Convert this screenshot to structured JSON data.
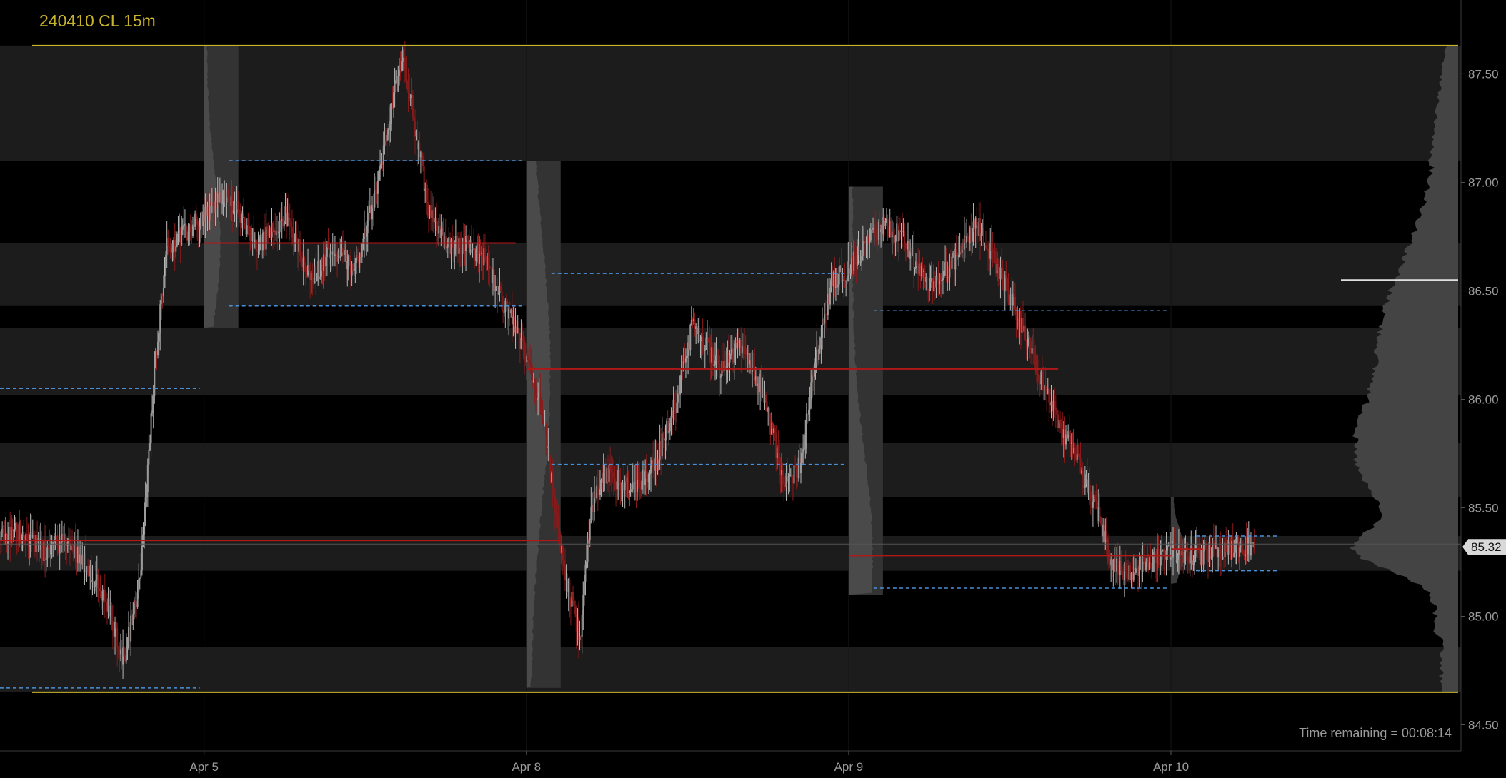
{
  "title": "240410 CL 15m",
  "footer": {
    "label": "Time remaining = ",
    "value": "00:08:14"
  },
  "colors": {
    "background": "#000000",
    "band_light": "#1c1c1c",
    "profile": "#5a5a5a",
    "candle": "#8a1a1a",
    "wick_up": "#b8b8b8",
    "poc": "#b01818",
    "value_area": "#4a90d9",
    "boundary": "#c8b42a",
    "last_price": "#d9d9d9",
    "axis_text": "#9a9a9a"
  },
  "chart_data": {
    "type": "candlestick",
    "instrument": "CL",
    "interval": "15m",
    "xlabel": "",
    "ylabel": "",
    "ylim": [
      84.38,
      87.84
    ],
    "y_ticks": [
      84.5,
      85.0,
      85.5,
      86.0,
      86.5,
      87.0,
      87.5
    ],
    "y_tick_labels": [
      "84.50",
      "85.00",
      "85.50",
      "86.00",
      "86.50",
      "87.00",
      "87.50"
    ],
    "x_ticks": [
      {
        "label": "Apr 5",
        "x": 3
      },
      {
        "label": "Apr 8",
        "x": 6
      },
      {
        "label": "Apr 9",
        "x": 9
      },
      {
        "label": "Apr 10",
        "x": 12
      }
    ],
    "xlim": [
      1.1,
      14.7
    ],
    "last_price": 85.32,
    "last_price_label": "85.32",
    "range_high": 87.63,
    "range_low": 84.65,
    "grid": false,
    "path": [
      [
        1.1,
        85.35
      ],
      [
        1.3,
        85.4
      ],
      [
        1.5,
        85.3
      ],
      [
        1.7,
        85.35
      ],
      [
        1.9,
        85.25
      ],
      [
        2.1,
        85.05
      ],
      [
        2.25,
        84.8
      ],
      [
        2.4,
        85.15
      ],
      [
        2.55,
        86.2
      ],
      [
        2.65,
        86.7
      ],
      [
        2.8,
        86.75
      ],
      [
        3.0,
        86.85
      ],
      [
        3.2,
        86.95
      ],
      [
        3.5,
        86.7
      ],
      [
        3.75,
        86.85
      ],
      [
        4.0,
        86.55
      ],
      [
        4.2,
        86.7
      ],
      [
        4.4,
        86.6
      ],
      [
        4.6,
        86.95
      ],
      [
        4.75,
        87.35
      ],
      [
        4.85,
        87.6
      ],
      [
        4.95,
        87.3
      ],
      [
        5.1,
        86.85
      ],
      [
        5.3,
        86.7
      ],
      [
        5.45,
        86.72
      ],
      [
        5.6,
        86.65
      ],
      [
        6.0,
        86.2
      ],
      [
        6.15,
        85.95
      ],
      [
        6.3,
        85.35
      ],
      [
        6.45,
        85.0
      ],
      [
        6.5,
        84.9
      ],
      [
        6.6,
        85.5
      ],
      [
        6.75,
        85.65
      ],
      [
        7.0,
        85.6
      ],
      [
        7.2,
        85.7
      ],
      [
        7.4,
        86.0
      ],
      [
        7.55,
        86.35
      ],
      [
        7.8,
        86.15
      ],
      [
        8.0,
        86.25
      ],
      [
        8.2,
        86.05
      ],
      [
        8.4,
        85.6
      ],
      [
        8.55,
        85.7
      ],
      [
        8.7,
        86.2
      ],
      [
        8.85,
        86.55
      ],
      [
        9.0,
        86.6
      ],
      [
        9.15,
        86.7
      ],
      [
        9.3,
        86.8
      ],
      [
        9.5,
        86.75
      ],
      [
        9.75,
        86.5
      ],
      [
        10.0,
        86.65
      ],
      [
        10.2,
        86.8
      ],
      [
        10.4,
        86.6
      ],
      [
        10.6,
        86.35
      ],
      [
        10.75,
        86.15
      ],
      [
        10.95,
        85.9
      ],
      [
        11.1,
        85.75
      ],
      [
        11.3,
        85.5
      ],
      [
        11.45,
        85.25
      ],
      [
        11.6,
        85.2
      ],
      [
        11.8,
        85.25
      ],
      [
        12.0,
        85.3
      ],
      [
        12.2,
        85.28
      ],
      [
        12.4,
        85.3
      ],
      [
        12.6,
        85.31
      ],
      [
        12.78,
        85.32
      ]
    ],
    "sessions": [
      {
        "start": 1.1,
        "end": 3.0,
        "poc": 85.35,
        "vah": 86.05,
        "val": 84.67,
        "poc_end": 6.3
      },
      {
        "start": 3.0,
        "end": 6.0,
        "poc": 86.72,
        "vah": 87.1,
        "val": 86.43,
        "poc_end": 5.9
      },
      {
        "start": 6.0,
        "end": 9.0,
        "poc": 86.14,
        "vah": 86.58,
        "val": 85.7,
        "poc_end": 10.95
      },
      {
        "start": 9.0,
        "end": 12.0,
        "poc": 85.28,
        "vah": 86.41,
        "val": 85.13,
        "poc_end": 12.0
      },
      {
        "start": 12.0,
        "end": 14.7,
        "poc": 85.31,
        "vah": 85.37,
        "val": 85.21,
        "poc_end": 12.3
      }
    ],
    "profiles": [
      {
        "start": 3.0,
        "top": 87.63,
        "bottom": 86.33,
        "center": 86.72,
        "width": 0.75,
        "shaded": true
      },
      {
        "start": 6.0,
        "top": 87.1,
        "bottom": 84.67,
        "center": 86.14,
        "width": 1.1,
        "shaded": true
      },
      {
        "start": 9.0,
        "top": 86.98,
        "bottom": 85.1,
        "center": 85.28,
        "width": 1.1,
        "shaded": true
      },
      {
        "start": 12.0,
        "top": 85.55,
        "bottom": 85.15,
        "center": 85.3,
        "width": 0.6,
        "shaded": false
      }
    ],
    "composite_profile": {
      "top": 87.63,
      "bottom": 84.65,
      "peak": 85.7,
      "anchor": 14.7,
      "bright_line": 86.55
    },
    "bands": [
      [
        87.63,
        87.1
      ],
      [
        86.72,
        86.43
      ],
      [
        86.33,
        86.02
      ],
      [
        85.8,
        85.55
      ],
      [
        85.37,
        85.21
      ],
      [
        84.86,
        84.65
      ]
    ]
  }
}
